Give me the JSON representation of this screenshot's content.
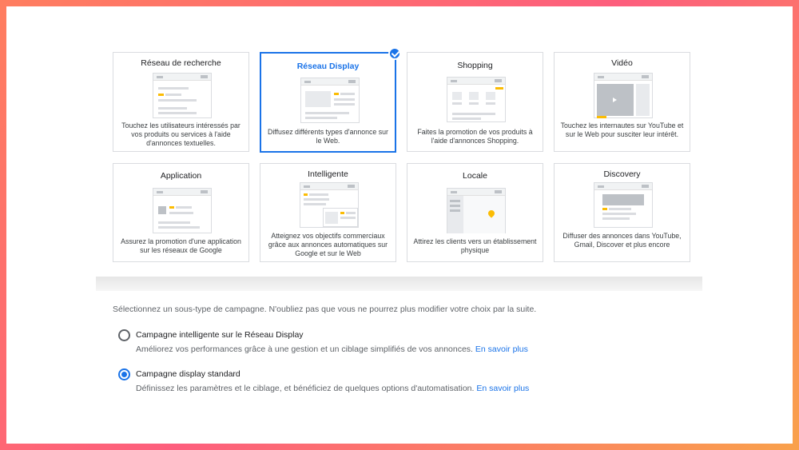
{
  "cards": [
    {
      "title": "Réseau de recherche",
      "desc": "Touchez les utilisateurs intéressés par vos produits ou services à l'aide d'annonces textuelles."
    },
    {
      "title": "Réseau Display",
      "desc": "Diffusez différents types d'annonce sur le Web.",
      "selected": true
    },
    {
      "title": "Shopping",
      "desc": "Faites la promotion de vos produits à l'aide d'annonces Shopping."
    },
    {
      "title": "Vidéo",
      "desc": "Touchez les internautes sur YouTube et sur le Web pour susciter leur intérêt."
    },
    {
      "title": "Application",
      "desc": "Assurez la promotion d'une application sur les réseaux de Google"
    },
    {
      "title": "Intelligente",
      "desc": "Atteignez vos objectifs commerciaux grâce aux annonces automatiques sur Google et sur le Web"
    },
    {
      "title": "Locale",
      "desc": "Attirez les clients vers un établissement physique"
    },
    {
      "title": "Discovery",
      "desc": "Diffuser des annonces dans YouTube, Gmail, Discover et plus encore"
    }
  ],
  "subtype": {
    "prompt": "Sélectionnez un sous-type de campagne. N'oubliez pas que vous ne pourrez plus modifier votre choix par la suite.",
    "options": [
      {
        "label": "Campagne intelligente sur le Réseau Display",
        "desc": "Améliorez vos performances grâce à une gestion et un ciblage simplifiés de vos annonces.",
        "link": "En savoir plus",
        "selected": false
      },
      {
        "label": "Campagne display standard",
        "desc": "Définissez les paramètres et le ciblage, et bénéficiez de quelques options d'automatisation.",
        "link": "En savoir plus",
        "selected": true
      }
    ]
  },
  "colors": {
    "accent": "#1a73e8",
    "highlight": "#fbbc04"
  }
}
